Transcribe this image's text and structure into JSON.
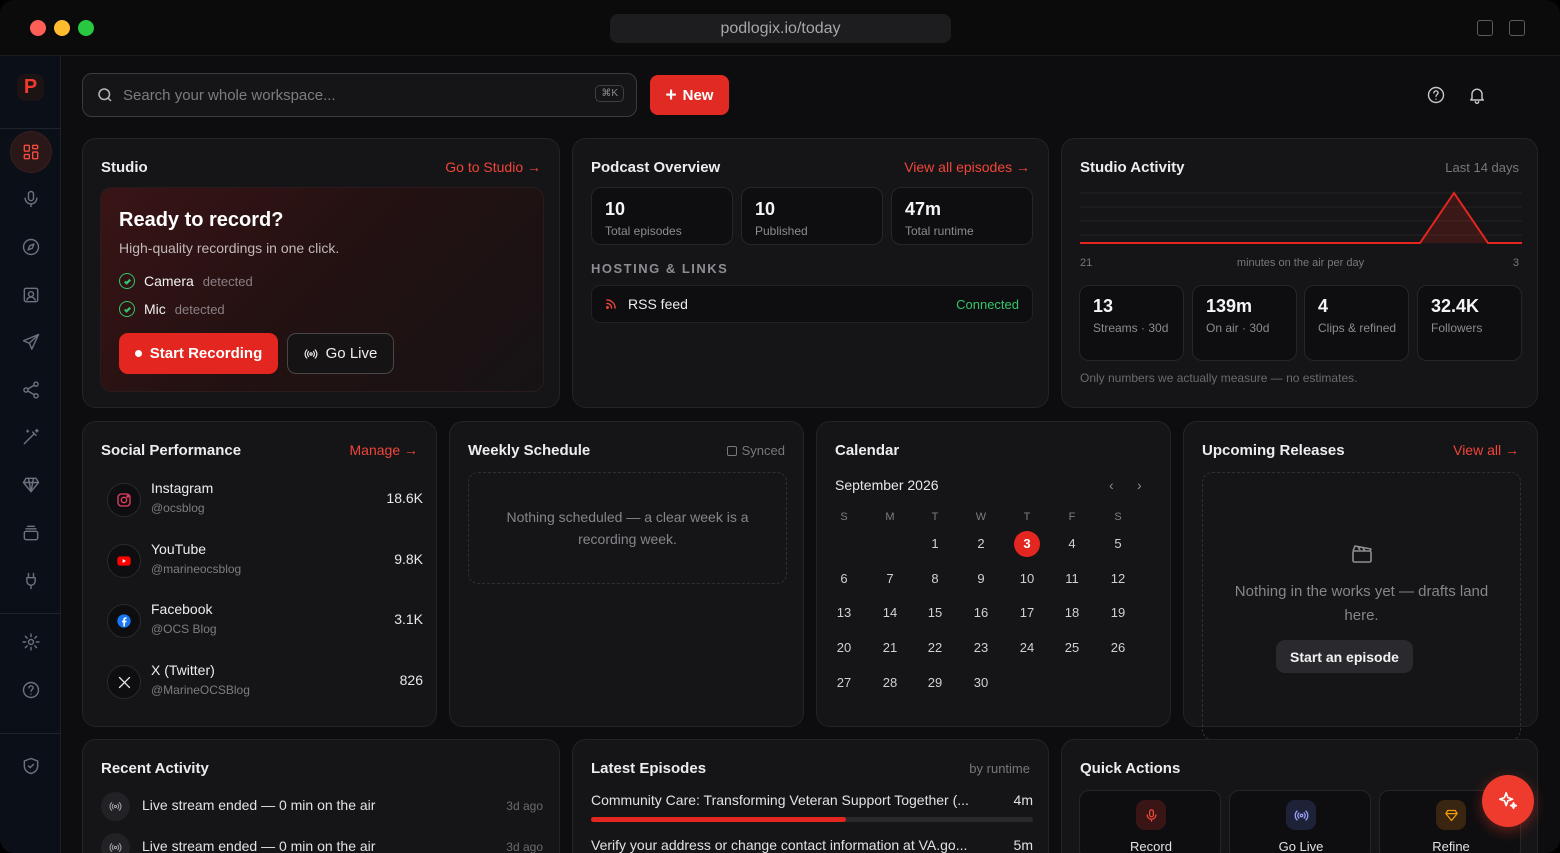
{
  "browser": {
    "url": "podlogix.io/today"
  },
  "logo": {
    "letter": "P"
  },
  "search": {
    "placeholder": "Search your whole workspace...",
    "shortcut": "⌘K"
  },
  "new_button": {
    "label": "New"
  },
  "studio": {
    "title": "Studio",
    "link": "Go to Studio →",
    "hero_title": "Ready to record?",
    "hero_subtitle": "High-quality recordings in one click.",
    "camera": {
      "label": "Camera",
      "status": "detected"
    },
    "mic": {
      "label": "Mic",
      "status": "detected"
    },
    "record_button": "Start Recording",
    "live_button": "Go Live"
  },
  "podcast": {
    "title": "Podcast Overview",
    "link": "View all episodes →",
    "stats": [
      {
        "value": "10",
        "label": "Total episodes"
      },
      {
        "value": "10",
        "label": "Published"
      },
      {
        "value": "47m",
        "label": "Total runtime"
      }
    ],
    "section_label": "HOSTING & LINKS",
    "rss": {
      "label": "RSS feed",
      "status": "Connected"
    }
  },
  "activity": {
    "title": "Studio Activity",
    "range": "Last 14 days",
    "axis_left": "21",
    "axis_caption": "minutes on the air per day",
    "axis_right": "3",
    "stats": [
      {
        "value": "13",
        "label": "Streams · 30d"
      },
      {
        "value": "139m",
        "label": "On air · 30d"
      },
      {
        "value": "4",
        "label": "Clips & refined"
      },
      {
        "value": "32.4K",
        "label": "Followers"
      }
    ],
    "note": "Only numbers we actually measure — no estimates."
  },
  "chart_data": {
    "type": "area",
    "x": [
      1,
      2,
      3,
      4,
      5,
      6,
      7,
      8,
      9,
      10,
      11,
      12,
      13,
      14
    ],
    "values": [
      0,
      0,
      0,
      0,
      0,
      0,
      0,
      0,
      0,
      0,
      0,
      139,
      0,
      0
    ],
    "xlabel": "minutes on the air per day",
    "ylabel": "",
    "color": "#e3261f"
  },
  "social": {
    "title": "Social Performance",
    "link": "Manage →",
    "items": [
      {
        "name": "Instagram",
        "handle": "@ocsblog",
        "count": "18.6K",
        "color": "#e4405f",
        "icon": "instagram-icon"
      },
      {
        "name": "YouTube",
        "handle": "@marineocsblog",
        "count": "9.8K",
        "color": "#ff0000",
        "icon": "youtube-icon"
      },
      {
        "name": "Facebook",
        "handle": "@OCS Blog",
        "count": "3.1K",
        "color": "#1877f2",
        "icon": "facebook-icon"
      },
      {
        "name": "X (Twitter)",
        "handle": "@MarineOCSBlog",
        "count": "826",
        "color": "#e8e8ea",
        "icon": "x-icon"
      }
    ]
  },
  "schedule": {
    "title": "Weekly Schedule",
    "status": "Synced",
    "empty": "Nothing scheduled — a clear week is a recording week."
  },
  "calendar": {
    "title": "Calendar",
    "month": "September 2026",
    "dow": [
      "S",
      "M",
      "T",
      "W",
      "T",
      "F",
      "S"
    ],
    "weeks": [
      [
        "",
        "",
        "1",
        "2",
        "3",
        "4",
        "5"
      ],
      [
        "6",
        "7",
        "8",
        "9",
        "10",
        "11",
        "12"
      ],
      [
        "13",
        "14",
        "15",
        "16",
        "17",
        "18",
        "19"
      ],
      [
        "20",
        "21",
        "22",
        "23",
        "24",
        "25",
        "26"
      ],
      [
        "27",
        "28",
        "29",
        "30",
        "",
        "",
        ""
      ]
    ],
    "today": "3"
  },
  "releases": {
    "title": "Upcoming Releases",
    "link": "View all →",
    "empty": "Nothing in the works yet — drafts land here.",
    "button": "Start an episode"
  },
  "recent": {
    "title": "Recent Activity",
    "items": [
      {
        "text": "Live stream ended — 0 min on the air",
        "ago": "3d ago"
      },
      {
        "text": "Live stream ended — 0 min on the air",
        "ago": "3d ago"
      }
    ]
  },
  "episodes": {
    "title": "Latest Episodes",
    "sort": "by runtime",
    "items": [
      {
        "title": "Community Care: Transforming Veteran Support Together (...",
        "runtime": "4m",
        "share": 0.76
      },
      {
        "title": "Verify your address or change contact information at VA.go...",
        "runtime": "5m",
        "share": 1.0
      }
    ]
  },
  "quick": {
    "title": "Quick Actions",
    "items": [
      {
        "label": "Record",
        "icon": "mic-icon",
        "color": "#e3261f"
      },
      {
        "label": "Go Live",
        "icon": "broadcast-icon",
        "color": "#7a8cff"
      },
      {
        "label": "Refine",
        "icon": "diamond-icon",
        "color": "#f59e0b"
      }
    ]
  }
}
